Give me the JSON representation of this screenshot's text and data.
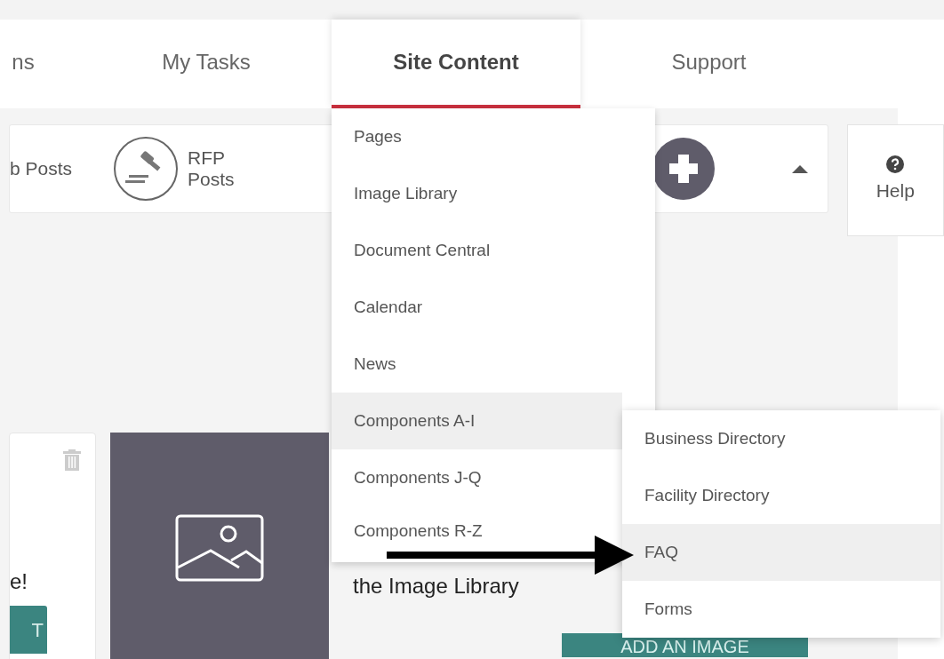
{
  "nav_tabs": [
    {
      "label": "ns",
      "selected": false
    },
    {
      "label": "My Tasks",
      "selected": false
    },
    {
      "label": "Site Content",
      "selected": true
    },
    {
      "label": "Support",
      "selected": false
    }
  ],
  "toolbar": {
    "items": [
      {
        "kind": "text",
        "label": "b Posts"
      },
      {
        "kind": "gavel",
        "label": "RFP Posts"
      },
      {
        "kind": "add"
      }
    ]
  },
  "help": {
    "label": "Help"
  },
  "left_card": {
    "text": "e!",
    "button": "T"
  },
  "description": "the Image Library",
  "add_button": "ADD AN IMAGE",
  "menu": {
    "items": [
      {
        "label": "Pages",
        "selected": false
      },
      {
        "label": "Image Library",
        "selected": false
      },
      {
        "label": "Document Central",
        "selected": false
      },
      {
        "label": "Calendar",
        "selected": false
      },
      {
        "label": "News",
        "selected": false
      },
      {
        "label": "Components A-I",
        "selected": true
      },
      {
        "label": "Components J-Q",
        "selected": false
      },
      {
        "label": "Components R-Z",
        "selected": false
      }
    ]
  },
  "submenu": {
    "items": [
      {
        "label": "Business Directory",
        "selected": false
      },
      {
        "label": "Facility Directory",
        "selected": false
      },
      {
        "label": "FAQ",
        "selected": true
      },
      {
        "label": "Forms",
        "selected": false
      }
    ]
  }
}
